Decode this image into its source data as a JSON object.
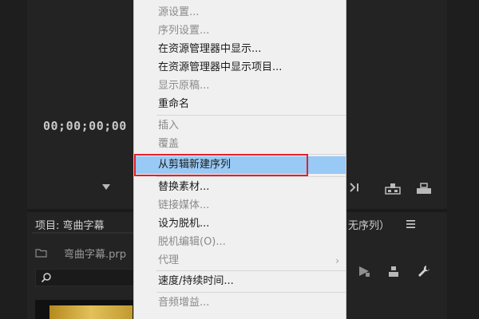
{
  "source_monitor": {
    "timecode": "00;00;00;00"
  },
  "project_panel": {
    "title": "项目: 弯曲字幕",
    "file_name": "弯曲字幕.prp",
    "sequence_label": "无序列）"
  },
  "menu": {
    "items": [
      {
        "label": "源设置...",
        "enabled": false
      },
      {
        "label": "序列设置...",
        "enabled": false
      },
      {
        "label": "在资源管理器中显示...",
        "enabled": true
      },
      {
        "label": "在资源管理器中显示项目...",
        "enabled": true
      },
      {
        "label": "显示原稿...",
        "enabled": false
      },
      {
        "label": "重命名",
        "enabled": true
      },
      {
        "label": "插入",
        "enabled": false
      },
      {
        "label": "覆盖",
        "enabled": false
      },
      {
        "label": "从剪辑新建序列",
        "enabled": true,
        "highlighted": true
      },
      {
        "label": "替换素材...",
        "enabled": true
      },
      {
        "label": "链接媒体...",
        "enabled": false
      },
      {
        "label": "设为脱机...",
        "enabled": true
      },
      {
        "label": "脱机编辑(O)...",
        "enabled": false
      },
      {
        "label": "代理",
        "enabled": false,
        "submenu": true
      },
      {
        "label": "速度/持续时间...",
        "enabled": true
      },
      {
        "label": "音频增益...",
        "enabled": false
      }
    ],
    "submenu_arrow": "›"
  },
  "colors": {
    "highlight": "#99c9f5",
    "annotation_box": "#e0202a"
  }
}
